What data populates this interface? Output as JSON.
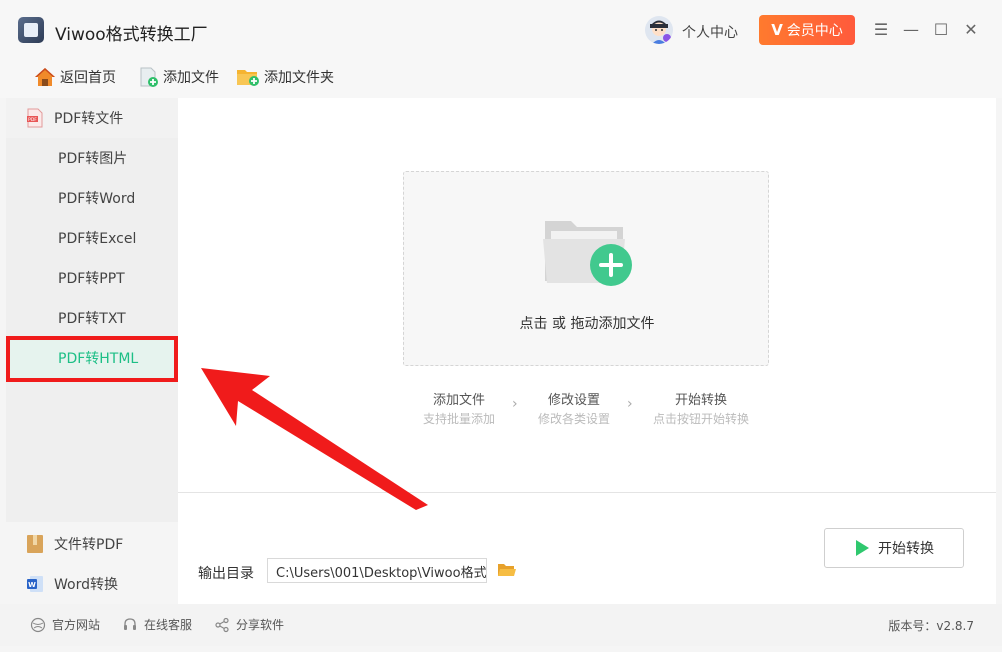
{
  "app": {
    "title": "Viwoo格式转换工厂"
  },
  "header": {
    "user_center": "个人中心",
    "vip_label": "会员中心",
    "vip_icon": "V"
  },
  "window_controls": {
    "menu": "☰",
    "minimize": "—",
    "maximize": "☐",
    "close": "✕"
  },
  "toolbar": {
    "home": "返回首页",
    "add_file": "添加文件",
    "add_folder": "添加文件夹"
  },
  "sidebar": {
    "group_pdf": "PDF转文件",
    "items": [
      "PDF转图片",
      "PDF转Word",
      "PDF转Excel",
      "PDF转PPT",
      "PDF转TXT",
      "PDF转HTML"
    ],
    "active_index": 5,
    "group_file_to_pdf": "文件转PDF",
    "group_word": "Word转换"
  },
  "dropzone": {
    "text": "点击 或 拖动添加文件"
  },
  "steps": [
    {
      "title": "添加文件",
      "desc": "支持批量添加"
    },
    {
      "title": "修改设置",
      "desc": "修改各类设置"
    },
    {
      "title": "开始转换",
      "desc": "点击按钮开始转换"
    }
  ],
  "output": {
    "label": "输出目录",
    "path": "C:\\Users\\001\\Desktop\\Viwoo格式 •••"
  },
  "start_button": {
    "label": "开始转换"
  },
  "statusbar": {
    "website": "官方网站",
    "service": "在线客服",
    "share": "分享软件",
    "version": "版本号：v2.8.7"
  },
  "colors": {
    "accent": "#1dbf86",
    "vip": "#ff6a34",
    "highlight": "#f01b1b"
  }
}
